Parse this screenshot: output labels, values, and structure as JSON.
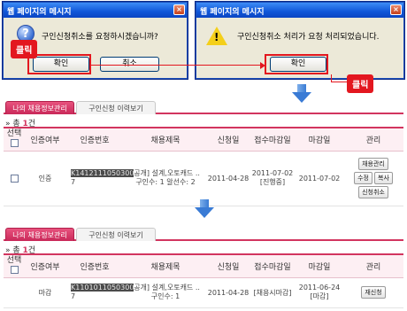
{
  "dialog1": {
    "title": "웹 페이지의 메시지",
    "close": "×",
    "icon": "question-icon",
    "message": "구인신청취소를 요청하시겠습니까?",
    "ok": "확인",
    "cancel": "취소"
  },
  "dialog2": {
    "title": "웹 페이지의 메시지",
    "close": "×",
    "icon": "warning-icon",
    "message": "구인신청취소 처리가 요청 처리되었습니다.",
    "ok": "확인"
  },
  "callouts": {
    "click1": "클릭",
    "click2": "클릭"
  },
  "colors": {
    "accent": "#d2355f",
    "callout": "#e3171f",
    "arrow": "#3a7bd5"
  },
  "panel1": {
    "tab_active": "나의 채용정보관리",
    "tab_inactive": "구인신청 이력보기",
    "total_prefix": "총 ",
    "total_count": "1",
    "total_suffix": "건",
    "headers": [
      "선택",
      "인증여부",
      "인증번호",
      "채용제목",
      "신청일",
      "접수마감일",
      "마감일",
      "관리"
    ],
    "row": {
      "status": "인증",
      "cert_hi": "K1412111050300",
      "cert_tail": "7",
      "title_line1": "[공개] 설계,오토캐드 ..",
      "title_line2": "구인수: 1 알선수: 2",
      "apply_date": "2011-04-28",
      "deadline_line1": "2011-07-02",
      "deadline_line2": "[진행중]",
      "close_date": "2011-07-02",
      "btn_manage": "채용관리",
      "btn_edit": "수정",
      "btn_copy": "복사",
      "btn_cancel": "신청취소"
    }
  },
  "panel2": {
    "tab_active": "나의 채용정보관리",
    "tab_inactive": "구인신청 이력보기",
    "total_prefix": "총 ",
    "total_count": "1",
    "total_suffix": "건",
    "headers": [
      "선택",
      "인증여부",
      "인증번호",
      "채용제목",
      "신청일",
      "접수마감일",
      "마감일",
      "관리"
    ],
    "row": {
      "status": "마감",
      "cert_hi": "K1101011050300",
      "cert_tail": "7",
      "title_line1": "[공개] 설계,오토캐드 ..",
      "title_line2": "구인수: 1",
      "apply_date": "2011-04-28",
      "deadline_line1": "[채용시마감]",
      "close_line1": "2011-06-24",
      "close_line2": "[마감]",
      "btn_reapply": "재신청"
    }
  }
}
